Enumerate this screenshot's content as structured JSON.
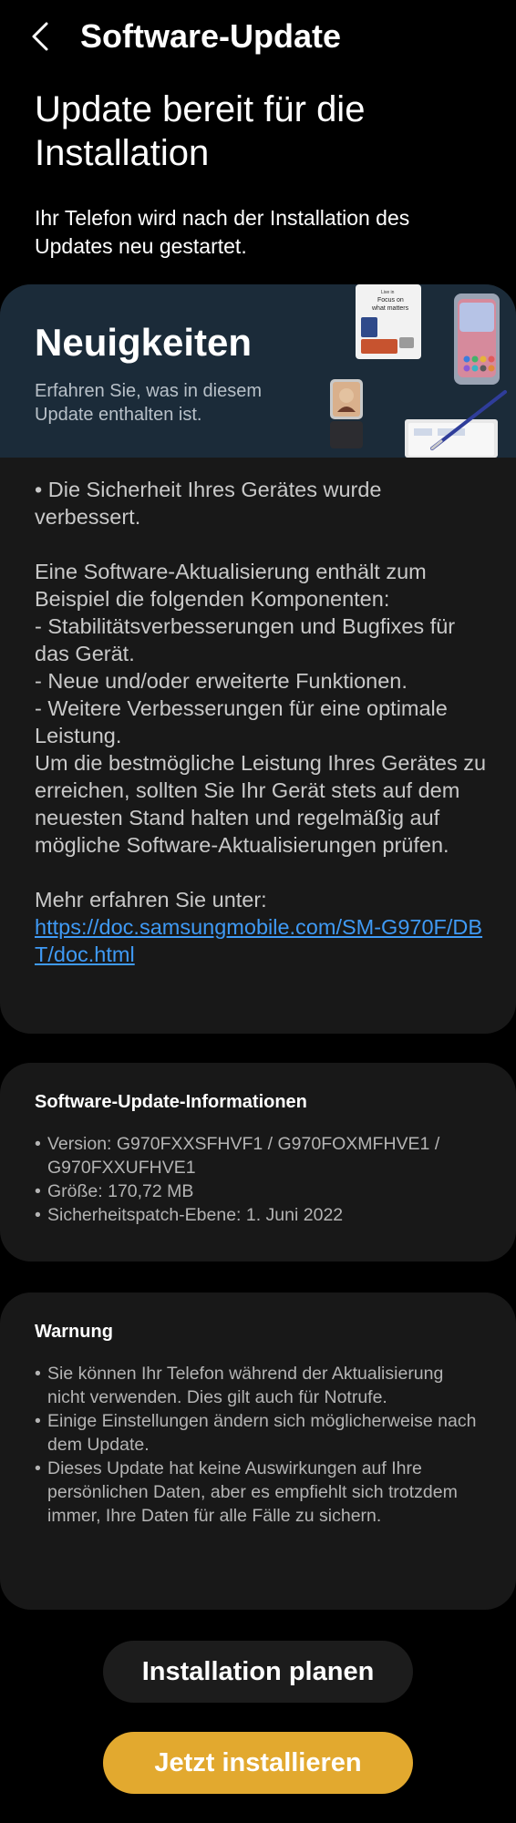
{
  "header": {
    "title": "Software-Update",
    "back_icon": "chevron-left-icon"
  },
  "status": {
    "headline": "Update bereit für die Installation",
    "subline": "Ihr Telefon wird nach der Installation des Updates neu gestartet."
  },
  "news": {
    "title": "Neuigkeiten",
    "subtitle": "Erfahren Sie, was in diesem Update enthalten ist.",
    "banner_color": "#1b2b39",
    "banner_card_text_1": "Live in",
    "banner_card_text_2": "Focus on",
    "banner_card_text_3": "what matters",
    "security_note": "• Die Sicherheit Ihres Gerätes wurde verbessert.",
    "components_intro": "Eine Software-Aktualisierung enthält zum Beispiel die folgenden Komponenten:",
    "component_1": " - Stabilitätsverbesserungen und Bugfixes für das Gerät.",
    "component_2": " - Neue und/oder erweiterte Funktionen.",
    "component_3": " - Weitere Verbesserungen für eine optimale Leistung.",
    "recommendation": "Um die bestmögliche Leistung Ihres Gerätes zu erreichen, sollten Sie Ihr Gerät stets auf dem neuesten Stand halten und regelmäßig auf mögliche Software-Aktualisierungen prüfen.",
    "more_info_label": "Mehr erfahren Sie unter:",
    "link": "https://doc.samsungmobile.com/SM-G970F/DBT/doc.html",
    "link_color": "#3f9af5"
  },
  "info": {
    "heading": "Software-Update-Informationen",
    "items": [
      "Version: G970FXXSFHVF1 / G970FOXMFHVE1 / G970FXXUFHVE1",
      "Größe: 170,72 MB",
      "Sicherheitspatch-Ebene: 1. Juni 2022"
    ]
  },
  "warning": {
    "heading": "Warnung",
    "items": [
      "Sie können Ihr Telefon während der Aktualisierung nicht verwenden. Dies gilt auch für Notrufe.",
      "Einige Einstellungen ändern sich möglicherweise nach dem Update.",
      "Dieses Update hat keine Auswirkungen auf Ihre persönlichen Daten, aber es empfiehlt sich trotzdem immer, Ihre Daten für alle Fälle zu sichern."
    ]
  },
  "actions": {
    "schedule_label": "Installation planen",
    "install_label": "Jetzt installieren",
    "install_color": "#e2a92f"
  }
}
